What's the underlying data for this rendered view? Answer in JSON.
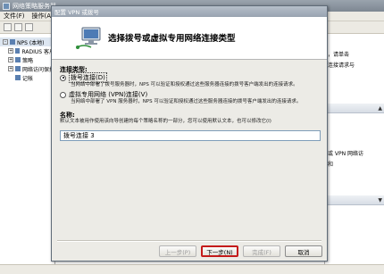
{
  "main_window": {
    "title": "网络策略服务器",
    "menu": [
      "文件(F)",
      "操作(A)"
    ],
    "tree": [
      {
        "label": "NPS (本地)",
        "expander": "-"
      },
      {
        "label": "RADIUS 客户",
        "expander": "+"
      },
      {
        "label": "策略",
        "expander": "+"
      },
      {
        "label": "网络访问保护",
        "expander": "+"
      },
      {
        "label": "记帐",
        "expander": ""
      }
    ],
    "actions_pane": {
      "header1": "",
      "text1": "，请单击",
      "text2": "连接请求与",
      "text3": "或 VPN 网络访",
      "text4": "和"
    }
  },
  "dialog": {
    "title": "配置 VPN 或拨号",
    "header_title": "选择拨号或虚拟专用网络连接类型",
    "connection_type_label": "连接类型:",
    "options": [
      {
        "label": "拨号连接(D)",
        "checked": true,
        "description": "当网络中部署了拨号服务器时，NPS 可以验证和授权通过这些服务器连接的拨号客户端发出的连接请求。"
      },
      {
        "label": "虚拟专用网络 (VPN)连接(V)",
        "checked": false,
        "description": "当网络中部署了 VPN 服务器时，NPS 可以验证和授权通过这些服务器连接的拨号客户端发出的连接请求。"
      }
    ],
    "name_label": "名称:",
    "name_description": "默认文本被用作使用该向导创建的每个策略名称的一部分，您可以使用默认文本，也可以修改它(I)",
    "name_value": "拨号连接 3",
    "buttons": {
      "previous": "上一步(P)",
      "next": "下一步(N)",
      "finish": "完成(F)",
      "cancel": "取消"
    }
  }
}
